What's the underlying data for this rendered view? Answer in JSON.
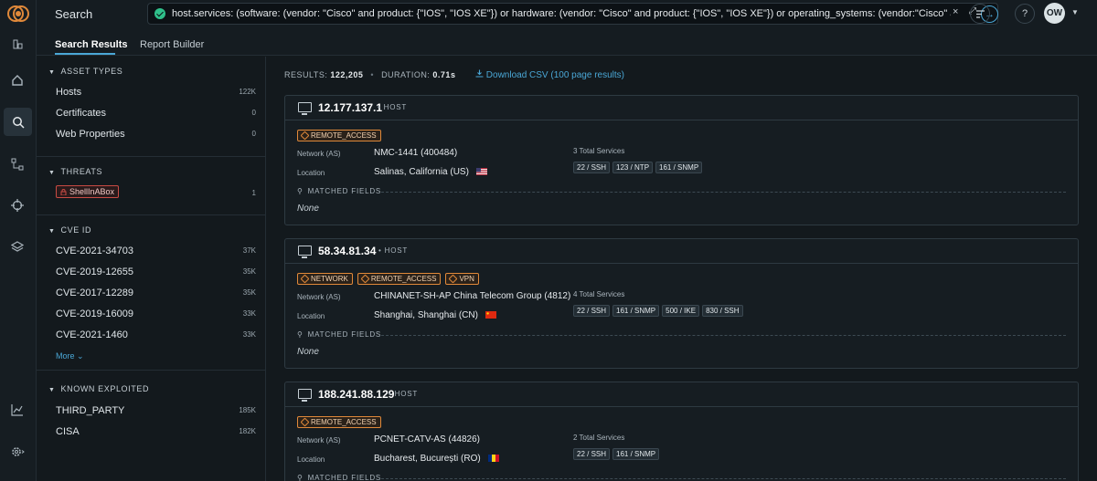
{
  "topbar": {
    "search_label": "Search",
    "query": "host.services: (software: (vendor: \"Cisco\" and product: {\"IOS\", \"IOS XE\"}) or hardware: (vendor: \"Cisco\" and product: {\"IOS\", \"IOS XE\"}) or operating_systems: (vendor:\"Cisco\" and product: {\"IOS\", \"I...",
    "clear_icon": "×",
    "expand_icon": "⤢",
    "go_icon": "→",
    "help_icon": "?",
    "avatar_initials": "OW"
  },
  "tabs": [
    {
      "label": "Search Results",
      "active": true
    },
    {
      "label": "Report Builder",
      "active": false
    }
  ],
  "filters": {
    "asset_types": {
      "title": "ASSET TYPES",
      "items": [
        {
          "label": "Hosts",
          "count": "122K"
        },
        {
          "label": "Certificates",
          "count": "0"
        },
        {
          "label": "Web Properties",
          "count": "0"
        }
      ]
    },
    "threats": {
      "title": "THREATS",
      "items": [
        {
          "label": "ShellInABox",
          "count": "1"
        }
      ]
    },
    "cve": {
      "title": "CVE ID",
      "items": [
        {
          "label": "CVE-2021-34703",
          "count": "37K"
        },
        {
          "label": "CVE-2019-12655",
          "count": "35K"
        },
        {
          "label": "CVE-2017-12289",
          "count": "35K"
        },
        {
          "label": "CVE-2019-16009",
          "count": "33K"
        },
        {
          "label": "CVE-2021-1460",
          "count": "33K"
        }
      ],
      "more_label": "More"
    },
    "known_exploited": {
      "title": "KNOWN EXPLOITED",
      "items": [
        {
          "label": "THIRD_PARTY",
          "count": "185K"
        },
        {
          "label": "CISA",
          "count": "182K"
        }
      ]
    }
  },
  "summary": {
    "results_label": "RESULTS:",
    "results_value": "122,205",
    "duration_label": "DURATION:",
    "duration_value": "0.71s",
    "download_label": "Download CSV (100 page results)"
  },
  "common": {
    "host_label": "HOST",
    "network_label": "Network (AS)",
    "location_label": "Location",
    "matched_fields_label": "MATCHED FIELDS",
    "none_label": "None"
  },
  "results": [
    {
      "ip": "12.177.137.1",
      "tags": [
        "REMOTE_ACCESS"
      ],
      "network": "NMC-1441 (400484)",
      "location": "Salinas, California (US)",
      "services_title": "3 Total Services",
      "services": [
        "22 / SSH",
        "123 / NTP",
        "161 / SNMP"
      ]
    },
    {
      "ip": "58.34.81.34",
      "tags": [
        "NETWORK",
        "REMOTE_ACCESS",
        "VPN"
      ],
      "network": "CHINANET-SH-AP China Telecom Group (4812)",
      "location": "Shanghai, Shanghai (CN)",
      "services_title": "4 Total Services",
      "services": [
        "22 / SSH",
        "161 / SNMP",
        "500 / IKE",
        "830 / SSH"
      ]
    },
    {
      "ip": "188.241.88.129",
      "tags": [
        "REMOTE_ACCESS"
      ],
      "network": "PCNET-CATV-AS (44826)",
      "location": "Bucharest, București (RO)",
      "services_title": "2 Total Services",
      "services": [
        "22 / SSH",
        "161 / SNMP"
      ]
    }
  ],
  "colors": {
    "accent": "#4aa7d6",
    "tag": "#e0893a",
    "threat": "#c94b44",
    "ok": "#2fbf8a"
  }
}
